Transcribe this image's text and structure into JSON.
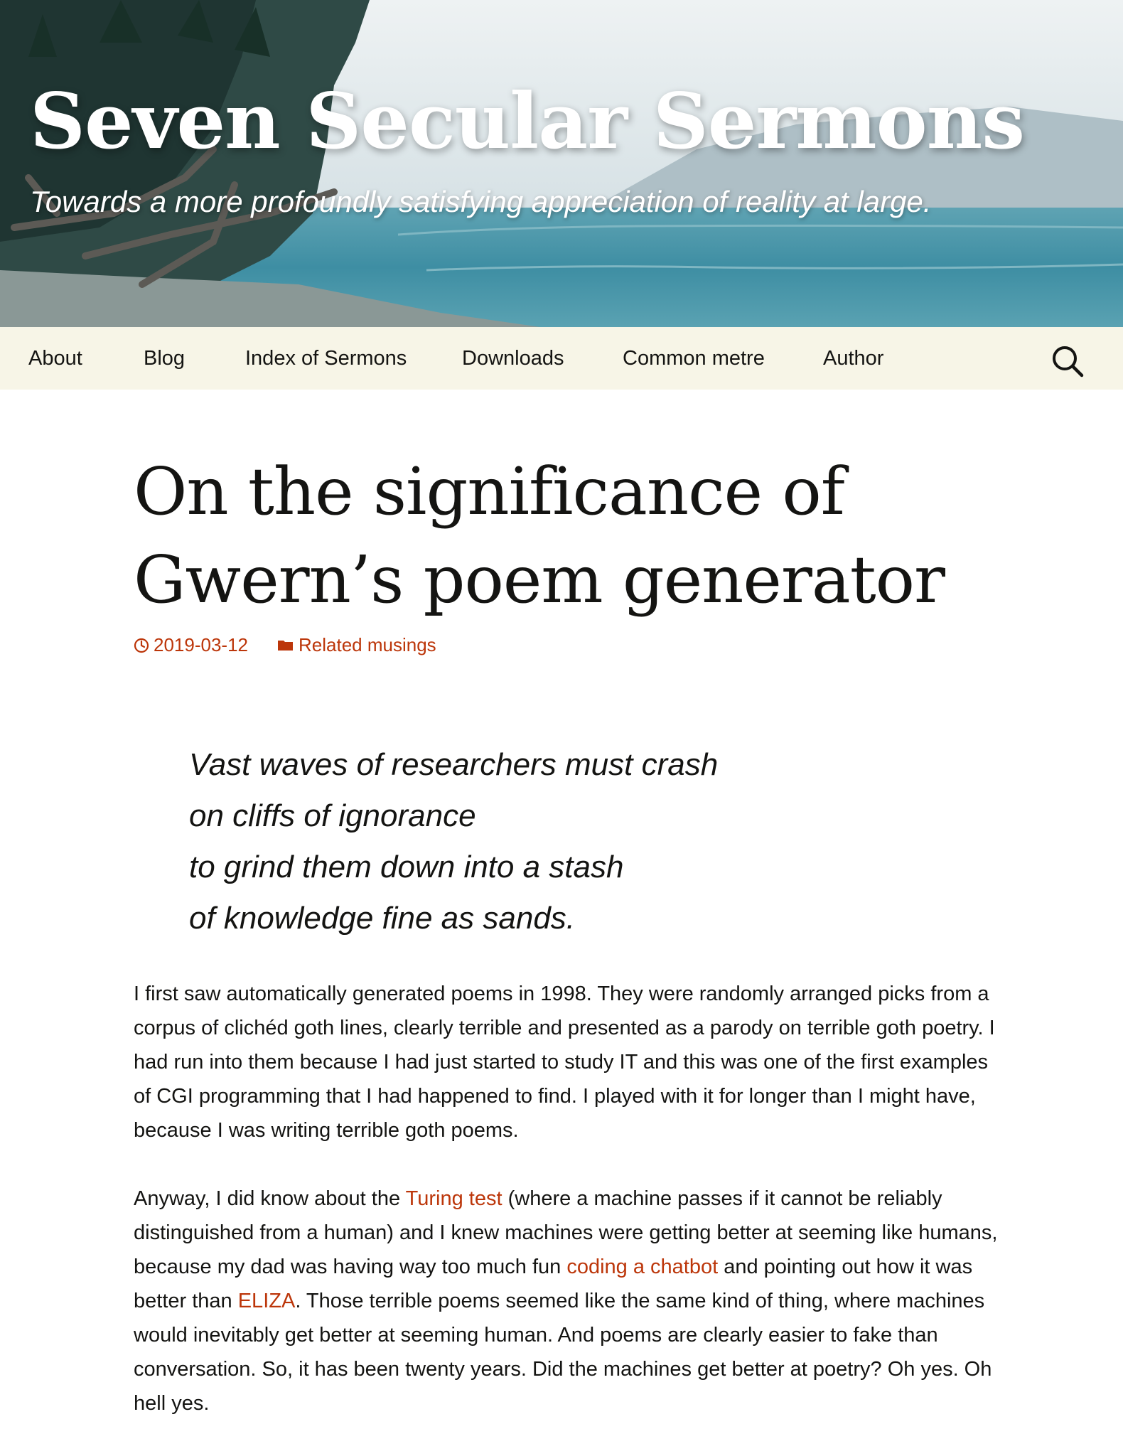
{
  "header": {
    "site_title": "Seven Secular Sermons",
    "tagline": "Towards a more profoundly satisfying appreciation of reality at large."
  },
  "nav": {
    "items": [
      {
        "label": "About"
      },
      {
        "label": "Blog"
      },
      {
        "label": "Index of Sermons"
      },
      {
        "label": "Downloads"
      },
      {
        "label": "Common metre"
      },
      {
        "label": "Author"
      }
    ],
    "search_icon": "search-icon"
  },
  "post": {
    "title": "On the significance of Gwern’s poem generator",
    "date": "2019-03-12",
    "category": "Related musings",
    "date_icon": "clock-icon",
    "category_icon": "folder-icon",
    "poem": [
      "Vast waves of researchers must crash",
      "on cliffs of ignorance",
      "to grind them down into a stash",
      "of knowledge fine as sands."
    ],
    "paragraph1": "I first saw automatically generated poems in 1998. They were randomly arranged picks from a corpus of clichéd goth lines, clearly terrible and presented as a parody on terrible goth poetry. I had run into them because I had just started to study IT and this was one of the first examples of CGI programming that I had happened to find. I played with it for longer than I might have, because I was writing terrible goth poems.",
    "paragraph2": {
      "t1": "Anyway, I did know about the ",
      "link1": "Turing test",
      "t2": " (where a machine passes if it cannot be reliably distinguished from a human) and I knew machines were getting better at seeming like humans, because my dad was having way too much fun ",
      "link2": "coding a chatbot",
      "t3": " and pointing out how it was better than ",
      "link3": "ELIZA",
      "t4": ". Those terrible poems seemed like the same kind of thing, where machines would inevitably get better at seeming human. And poems are clearly easier to fake than conversation. So, it has been twenty years. Did the machines get better at poetry? Oh yes. Oh hell yes."
    }
  },
  "colors": {
    "link": "#bc360a",
    "nav_background": "#f7f5e7",
    "text": "#141412"
  }
}
